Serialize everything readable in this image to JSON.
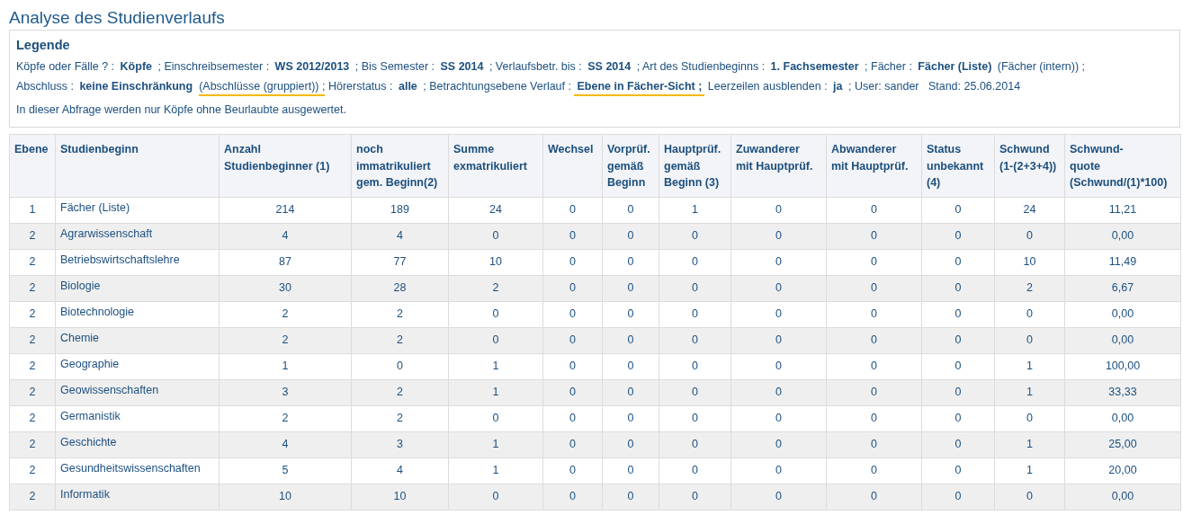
{
  "page_title": "Analyse des Studienverlaufs",
  "legend": {
    "title": "Legende",
    "lines": [
      [
        {
          "text": "Köpfe oder Fälle ? : ",
          "kind": "label",
          "highlighted": false
        },
        {
          "text": "Köpfe",
          "kind": "value",
          "highlighted": false
        },
        {
          "text": " ; Einschreibsemester : ",
          "kind": "label",
          "highlighted": false
        },
        {
          "text": "WS 2012/2013",
          "kind": "value",
          "highlighted": false
        },
        {
          "text": " ; Bis Semester : ",
          "kind": "label",
          "highlighted": false
        },
        {
          "text": "SS 2014",
          "kind": "value",
          "highlighted": false
        },
        {
          "text": " ; Verlaufsbetr. bis : ",
          "kind": "label",
          "highlighted": false
        },
        {
          "text": "SS 2014",
          "kind": "value",
          "highlighted": false
        },
        {
          "text": " ; Art des Studienbeginns : ",
          "kind": "label",
          "highlighted": false
        },
        {
          "text": "1. Fachsemester",
          "kind": "value",
          "highlighted": false
        },
        {
          "text": " ; Fächer : ",
          "kind": "label",
          "highlighted": false
        },
        {
          "text": "Fächer (Liste)",
          "kind": "value",
          "highlighted": false
        },
        {
          "text": " (Fächer (intern)) ;",
          "kind": "label",
          "highlighted": false
        }
      ],
      [
        {
          "text": "Abschluss : ",
          "kind": "label",
          "highlighted": false
        },
        {
          "text": "keine Einschränkung",
          "kind": "value",
          "highlighted": false
        },
        {
          "text": "(Abschlüsse (gruppiert)) ;",
          "kind": "label",
          "highlighted": true
        },
        {
          "text": " Hörerstatus : ",
          "kind": "label",
          "highlighted": false
        },
        {
          "text": "alle",
          "kind": "value",
          "highlighted": false
        },
        {
          "text": " ; Betrachtungsebene Verlauf : ",
          "kind": "label",
          "highlighted": false
        },
        {
          "text": "Ebene in Fächer-Sicht ;",
          "kind": "value",
          "highlighted": true
        },
        {
          "text": " Leerzeilen ausblenden : ",
          "kind": "label",
          "highlighted": false
        },
        {
          "text": "ja",
          "kind": "value",
          "highlighted": false
        },
        {
          "text": " ; User: sander   Stand: 25.06.2014",
          "kind": "label",
          "highlighted": false
        }
      ]
    ],
    "note": "In dieser Abfrage werden nur Köpfe ohne Beurlaubte ausgewertet."
  },
  "table": {
    "columns": [
      "Ebene",
      "Studienbeginn",
      "Anzahl\nStudienbeginner (1)",
      "noch\nimmatrikuliert\ngem. Beginn(2)",
      "Summe\nexmatrikuliert",
      "Wechsel",
      "Vorprüf.\ngemäß\nBeginn",
      "Hauptprüf.\ngemäß\nBeginn (3)",
      "Zuwanderer\nmit Hauptprüf.",
      "Abwanderer\nmit Hauptprüf.",
      "Status\nunbekannt\n(4)",
      "Schwund\n(1-(2+3+4))",
      "Schwund-\nquote\n(Schwund/(1)*100)"
    ],
    "rows": [
      [
        "1",
        "Fächer (Liste)",
        "214",
        "189",
        "24",
        "0",
        "0",
        "1",
        "0",
        "0",
        "0",
        "24",
        "11,21"
      ],
      [
        "2",
        "Agrarwissenschaft",
        "4",
        "4",
        "0",
        "0",
        "0",
        "0",
        "0",
        "0",
        "0",
        "0",
        "0,00"
      ],
      [
        "2",
        "Betriebswirtschaftslehre",
        "87",
        "77",
        "10",
        "0",
        "0",
        "0",
        "0",
        "0",
        "0",
        "10",
        "11,49"
      ],
      [
        "2",
        "Biologie",
        "30",
        "28",
        "2",
        "0",
        "0",
        "0",
        "0",
        "0",
        "0",
        "2",
        "6,67"
      ],
      [
        "2",
        "Biotechnologie",
        "2",
        "2",
        "0",
        "0",
        "0",
        "0",
        "0",
        "0",
        "0",
        "0",
        "0,00"
      ],
      [
        "2",
        "Chemie",
        "2",
        "2",
        "0",
        "0",
        "0",
        "0",
        "0",
        "0",
        "0",
        "0",
        "0,00"
      ],
      [
        "2",
        "Geographie",
        "1",
        "0",
        "1",
        "0",
        "0",
        "0",
        "0",
        "0",
        "0",
        "1",
        "100,00"
      ],
      [
        "2",
        "Geowissenschaften",
        "3",
        "2",
        "1",
        "0",
        "0",
        "0",
        "0",
        "0",
        "0",
        "1",
        "33,33"
      ],
      [
        "2",
        "Germanistik",
        "2",
        "2",
        "0",
        "0",
        "0",
        "0",
        "0",
        "0",
        "0",
        "0",
        "0,00"
      ],
      [
        "2",
        "Geschichte",
        "4",
        "3",
        "1",
        "0",
        "0",
        "0",
        "0",
        "0",
        "0",
        "1",
        "25,00"
      ],
      [
        "2",
        "Gesundheitswissenschaften",
        "5",
        "4",
        "1",
        "0",
        "0",
        "0",
        "0",
        "0",
        "0",
        "1",
        "20,00"
      ],
      [
        "2",
        "Informatik",
        "10",
        "10",
        "0",
        "0",
        "0",
        "0",
        "0",
        "0",
        "0",
        "0",
        "0,00"
      ]
    ]
  }
}
